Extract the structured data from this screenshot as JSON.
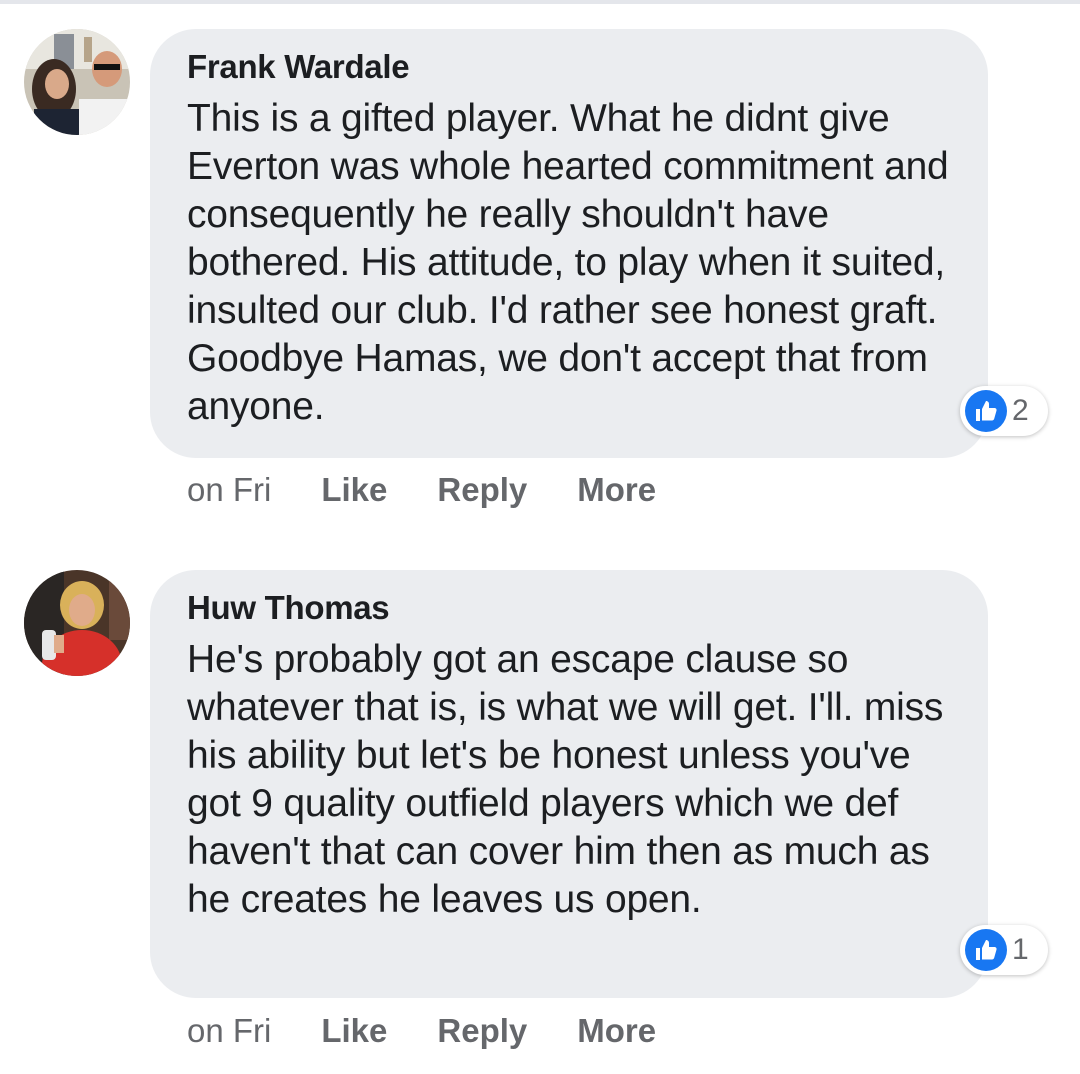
{
  "comments": [
    {
      "author": "Frank Wardale",
      "text": "This is a gifted player. What he didnt give Everton was whole hearted commitment and consequently he really shouldn't have bothered. His attitude, to play when it suited, insulted our club. I'd rather see honest graft. Goodbye Hamas, we don't accept that from anyone.",
      "reaction_icon": "thumbs-up-icon",
      "reaction_count": "2",
      "time": "on Fri",
      "like_label": "Like",
      "reply_label": "Reply",
      "more_label": "More"
    },
    {
      "author": "Huw Thomas",
      "text": "He's probably got an escape clause so whatever that is, is what we will get. I'll. miss his ability but let's be honest unless you've got 9 quality outfield players which we def haven't that can cover him then as much as he creates he leaves us open.",
      "reaction_icon": "thumbs-up-icon",
      "reaction_count": "1",
      "time": "on Fri",
      "like_label": "Like",
      "reply_label": "Reply",
      "more_label": "More"
    }
  ],
  "colors": {
    "bubble": "#ebedf0",
    "text": "#1c1e21",
    "meta": "#65676b",
    "like_blue": "#1877f2"
  }
}
